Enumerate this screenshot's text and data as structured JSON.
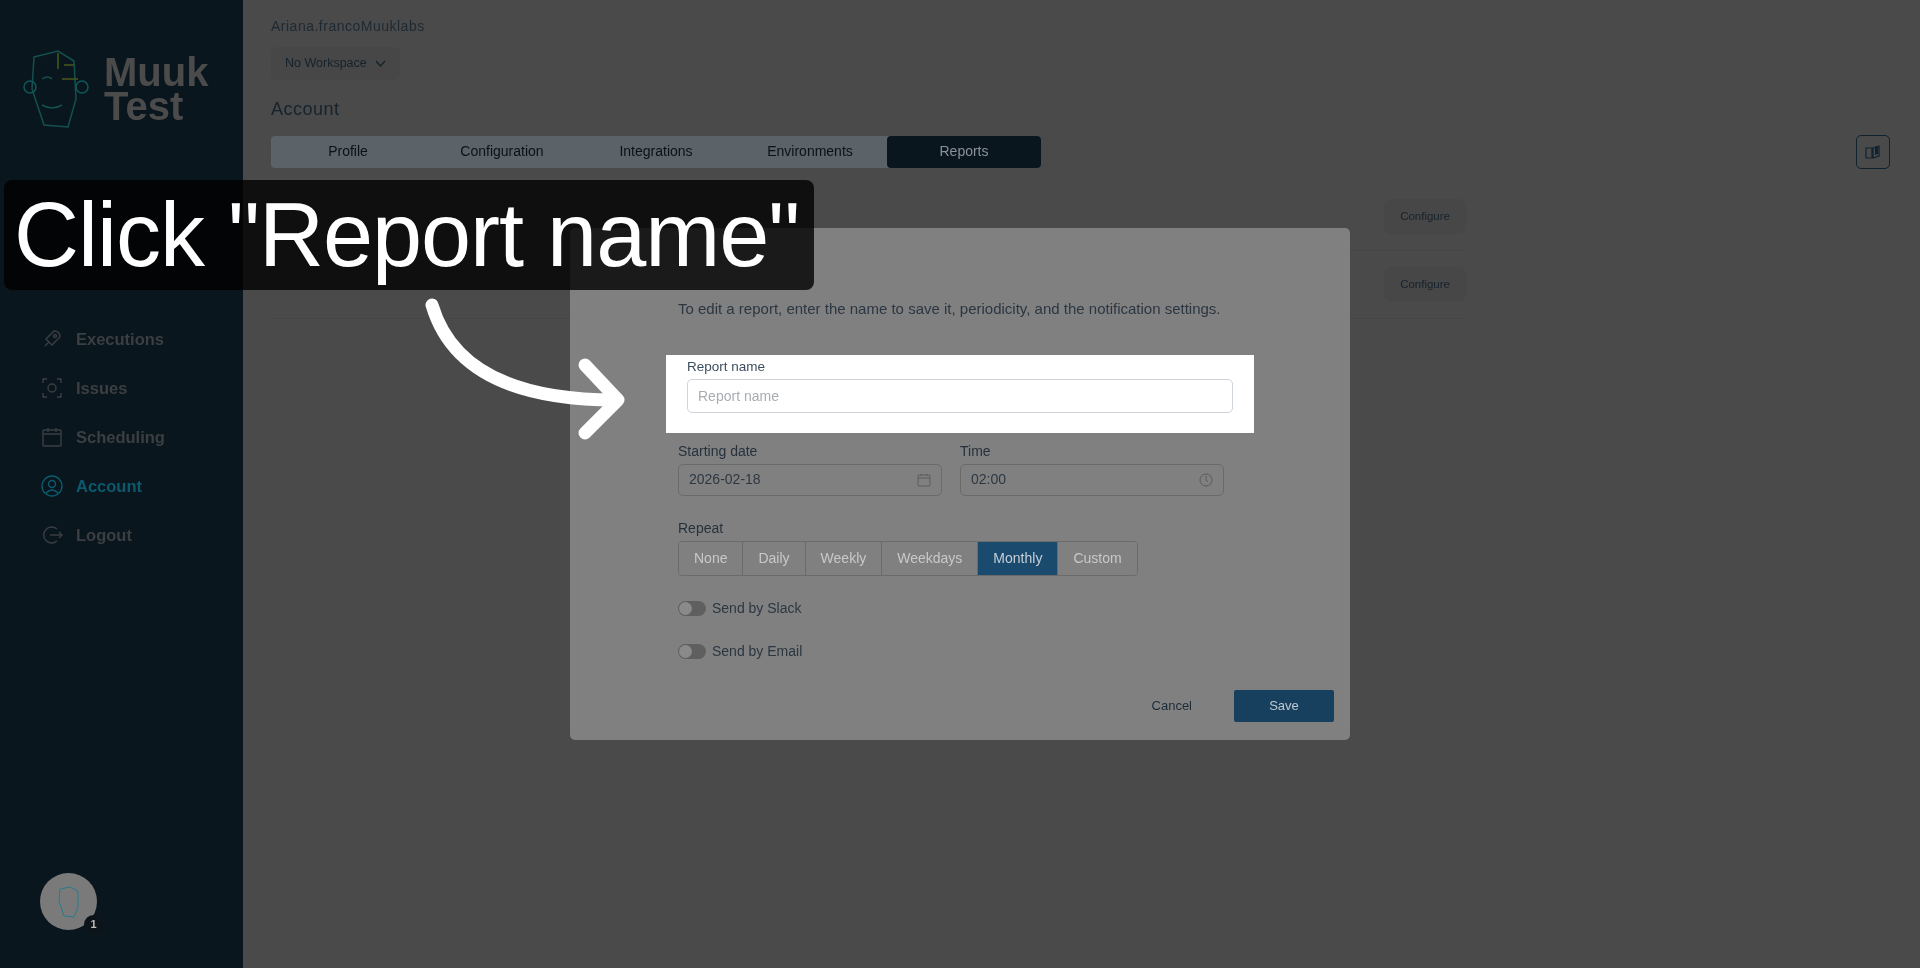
{
  "logo": {
    "line_1": "Muuk",
    "line_2": "Test"
  },
  "sidebar": {
    "items": [
      {
        "label": "Executions",
        "selected": false
      },
      {
        "label": "Issues",
        "selected": false
      },
      {
        "label": "Scheduling",
        "selected": false
      },
      {
        "label": "Account",
        "selected": true
      },
      {
        "label": "Logout",
        "selected": false
      }
    ]
  },
  "avatar": {
    "badge": "1"
  },
  "user": {
    "name": "Ariana.francoMuuklabs",
    "workspace": "No Workspace"
  },
  "page_title": "Account",
  "tabs": [
    {
      "label": "Profile",
      "selected": false
    },
    {
      "label": "Configuration",
      "selected": false
    },
    {
      "label": "Integrations",
      "selected": false
    },
    {
      "label": "Environments",
      "selected": false
    },
    {
      "label": "Reports",
      "selected": true
    }
  ],
  "report_rows": [
    {
      "button": "Configure"
    },
    {
      "button": "Configure"
    }
  ],
  "modal": {
    "description": "To edit a report, enter the name to save it, periodicity, and the notification settings.",
    "report_name": {
      "label": "Report name",
      "placeholder": "Report name"
    },
    "starting_date": {
      "label": "Starting date",
      "value": "2026-02-18"
    },
    "time": {
      "label": "Time",
      "value": "02:00"
    },
    "repeat": {
      "label": "Repeat",
      "options": [
        {
          "label": "None",
          "selected": false
        },
        {
          "label": "Daily",
          "selected": false
        },
        {
          "label": "Weekly",
          "selected": false
        },
        {
          "label": "Weekdays",
          "selected": false
        },
        {
          "label": "Monthly",
          "selected": true
        },
        {
          "label": "Custom",
          "selected": false
        }
      ]
    },
    "toggles": [
      {
        "label": "Send by Slack",
        "on": false
      },
      {
        "label": "Send by Email",
        "on": false
      }
    ],
    "cancel": "Cancel",
    "save": "Save"
  },
  "callout": {
    "text": "Click \"Report name\""
  }
}
